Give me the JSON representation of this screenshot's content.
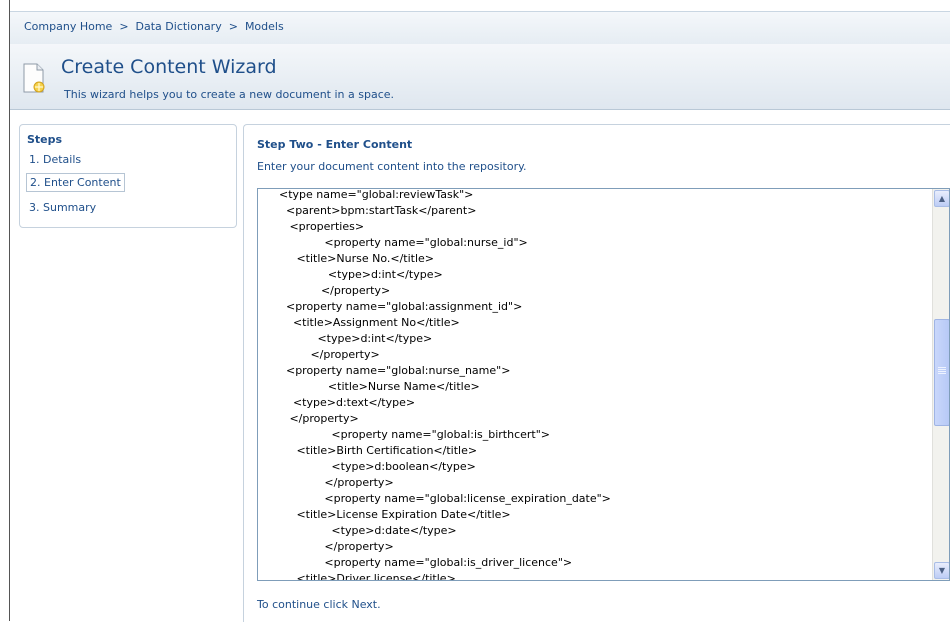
{
  "breadcrumb": {
    "items": [
      "Company Home",
      "Data Dictionary",
      "Models"
    ],
    "separator": ">"
  },
  "wizard": {
    "title": "Create Content Wizard",
    "description": "This wizard helps you to create a new document in a space."
  },
  "steps": {
    "title": "Steps",
    "items": [
      {
        "label": "1. Details",
        "active": false
      },
      {
        "label": "2. Enter Content",
        "active": true
      },
      {
        "label": "3. Summary",
        "active": false
      }
    ]
  },
  "content": {
    "title": "Step Two - Enter Content",
    "subtitle": "Enter your document content into the repository.",
    "footer": "To continue click Next."
  },
  "editor": {
    "lines": [
      "      <type name=\"global:reviewTask\">",
      "        <parent>bpm:startTask</parent>",
      "         <properties>",
      "                   <property name=\"global:nurse_id\">",
      "           <title>Nurse No.</title>",
      "                    <type>d:int</type>",
      "                  </property>",
      "        <property name=\"global:assignment_id\">",
      "          <title>Assignment No</title>",
      "                 <type>d:int</type>",
      "               </property>",
      "        <property name=\"global:nurse_name\">",
      "                    <title>Nurse Name</title>",
      "          <type>d:text</type>",
      "         </property>",
      "                     <property name=\"global:is_birthcert\">",
      "           <title>Birth Certification</title>",
      "                     <type>d:boolean</type>",
      "                   </property>",
      "                   <property name=\"global:license_expiration_date\">",
      "           <title>License Expiration Date</title>",
      "                     <type>d:date</type>",
      "                   </property>",
      "                   <property name=\"global:is_driver_licence\">",
      "           <title>Driver license</title>"
    ]
  },
  "colors": {
    "accent": "#1f4f8a",
    "border": "#c6d2de",
    "editor_border": "#7f9db9"
  },
  "icons": {
    "document": "new-document-icon",
    "scroll_up": "scroll-up-icon",
    "scroll_down": "scroll-down-icon"
  }
}
